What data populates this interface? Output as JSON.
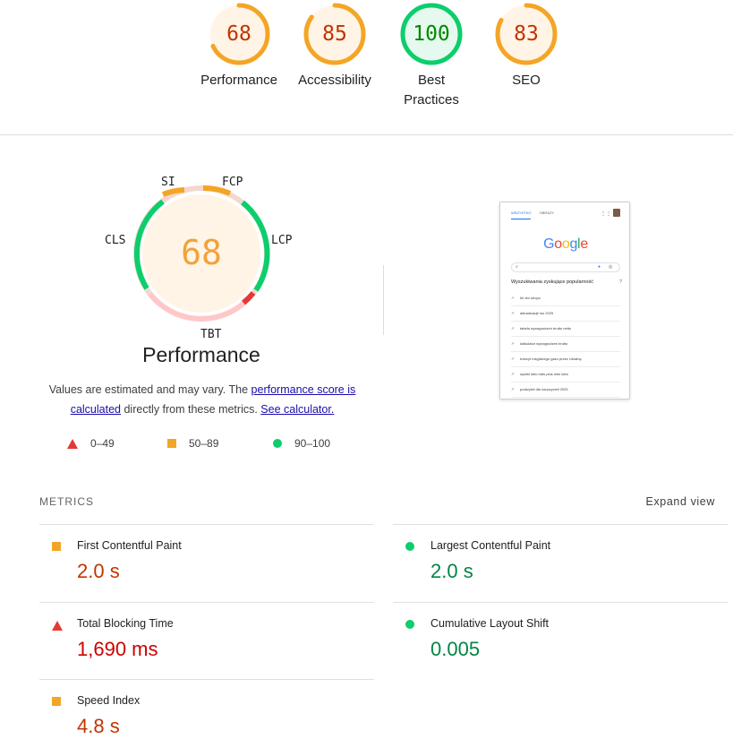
{
  "categories": [
    {
      "label": "Performance",
      "score": "68",
      "value": 68,
      "status": "average",
      "color": "#f4a526",
      "text_color": "#c33300",
      "fill": "#fff4e5"
    },
    {
      "label": "Accessibility",
      "score": "85",
      "value": 85,
      "status": "average",
      "color": "#f4a526",
      "text_color": "#c33300",
      "fill": "#fff4e5"
    },
    {
      "label": "Best Practices",
      "score": "100",
      "value": 100,
      "status": "pass",
      "color": "#0cce6b",
      "text_color": "#008800",
      "fill": "#e6f9ee"
    },
    {
      "label": "SEO",
      "score": "83",
      "value": 83,
      "status": "average",
      "color": "#f4a526",
      "text_color": "#c33300",
      "fill": "#fff4e5"
    }
  ],
  "performance": {
    "title": "Performance",
    "score": "68",
    "metric_tags": {
      "si": "SI",
      "fcp": "FCP",
      "lcp": "LCP",
      "tbt": "TBT",
      "cls": "CLS"
    },
    "description": {
      "prefix": "Values are estimated and may vary. The ",
      "link1": "performance score is calculated",
      "middle": " directly from these metrics. ",
      "link2": "See calculator."
    },
    "legend": [
      {
        "shape": "triangle",
        "range": "0–49",
        "color": "#e53935"
      },
      {
        "shape": "square",
        "range": "50–89",
        "color": "#f4a526"
      },
      {
        "shape": "circle",
        "range": "90–100",
        "color": "#0cce6b"
      }
    ]
  },
  "screenshot": {
    "tabs": [
      "WSZYSTKO",
      "OBRAZY"
    ],
    "apps_icon": "apps-grid-icon",
    "logo": "Google",
    "heading": "Wyszukiwania zyskujące popularność",
    "rows": [
      "Ile dni urlopu",
      "aktualizacje ios 2025",
      "tabela wynagrodzeń brutto netto",
      "kalkulator wynagrodzeń brutto",
      "tranzyt rosyjskiego gazu przez Ukrainę",
      "wyniki lotto lotto plus mini lotto",
      "podwyżki dla nauczycieli 2025"
    ]
  },
  "metrics": {
    "header": "METRICS",
    "expand": "Expand view",
    "items": [
      {
        "label": "First Contentful Paint",
        "value": "2.0 s",
        "status": "average"
      },
      {
        "label": "Largest Contentful Paint",
        "value": "2.0 s",
        "status": "pass"
      },
      {
        "label": "Total Blocking Time",
        "value": "1,690 ms",
        "status": "fail"
      },
      {
        "label": "Cumulative Layout Shift",
        "value": "0.005",
        "status": "pass"
      },
      {
        "label": "Speed Index",
        "value": "4.8 s",
        "status": "average"
      }
    ]
  }
}
